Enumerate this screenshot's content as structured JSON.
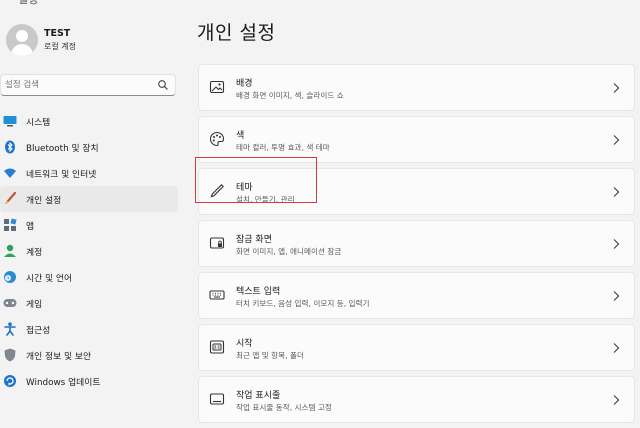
{
  "window": {
    "title_fragment": "설정"
  },
  "profile": {
    "name": "TEST",
    "account_type": "로컬 계정"
  },
  "search": {
    "placeholder": "설정 검색"
  },
  "sidebar": {
    "items": [
      {
        "label": "시스템",
        "icon": "monitor-icon"
      },
      {
        "label": "Bluetooth 및 장치",
        "icon": "bluetooth-icon"
      },
      {
        "label": "네트워크 및 인터넷",
        "icon": "wifi-icon"
      },
      {
        "label": "개인 설정",
        "icon": "brush-icon",
        "active": true
      },
      {
        "label": "앱",
        "icon": "apps-icon"
      },
      {
        "label": "계정",
        "icon": "account-icon"
      },
      {
        "label": "시간 및 언어",
        "icon": "globe-clock-icon"
      },
      {
        "label": "게임",
        "icon": "gamepad-icon"
      },
      {
        "label": "접근성",
        "icon": "accessibility-icon"
      },
      {
        "label": "개인 정보 및 보안",
        "icon": "shield-icon"
      },
      {
        "label": "Windows 업데이트",
        "icon": "update-icon"
      }
    ]
  },
  "main": {
    "title": "개인 설정",
    "cards": [
      {
        "title": "배경",
        "subtitle": "배경 화면 이미지, 색, 슬라이드 쇼",
        "icon": "image-icon"
      },
      {
        "title": "색",
        "subtitle": "테마 컬러, 투명 효과, 색 테마",
        "icon": "palette-icon"
      },
      {
        "title": "테마",
        "subtitle": "설치, 만들기, 관리",
        "icon": "pen-icon",
        "highlighted": true
      },
      {
        "title": "잠금 화면",
        "subtitle": "화면 이미지, 앱, 애니메이션 잠금",
        "icon": "lock-screen-icon"
      },
      {
        "title": "텍스트 입력",
        "subtitle": "터치 키보드, 음성 입력, 이모지 등, 입력기",
        "icon": "keyboard-icon"
      },
      {
        "title": "시작",
        "subtitle": "최근 앱 및 항목, 폴더",
        "icon": "start-icon"
      },
      {
        "title": "작업 표시줄",
        "subtitle": "작업 표시줄 동작, 시스템 고정",
        "icon": "taskbar-icon"
      }
    ]
  },
  "colors": {
    "accent": "#0067c0",
    "highlight": "#d9393b"
  }
}
